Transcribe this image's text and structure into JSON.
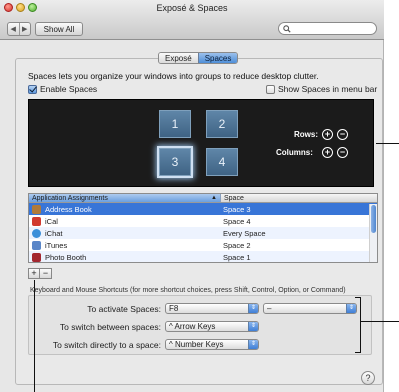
{
  "window": {
    "title": "Exposé & Spaces"
  },
  "toolbar": {
    "back_icon": "◀",
    "forward_icon": "▶",
    "show_all_label": "Show All",
    "search_value": "",
    "search_placeholder": ""
  },
  "tabs": [
    {
      "label": "Exposé",
      "active": false
    },
    {
      "label": "Spaces",
      "active": true
    }
  ],
  "spaces": {
    "intro": "Spaces lets you organize your windows into groups to reduce desktop clutter.",
    "enable_label": "Enable Spaces",
    "enable_checked": true,
    "show_menubar_label": "Show Spaces in menu bar",
    "show_menubar_checked": false,
    "tiles": [
      "1",
      "2",
      "3",
      "4"
    ],
    "selected_tile": "3",
    "rows_label": "Rows:",
    "columns_label": "Columns:",
    "plus": "+",
    "minus": "−"
  },
  "assignments": {
    "headers": {
      "app": "Application Assignments",
      "space": "Space",
      "sort_icon": "▲"
    },
    "rows": [
      {
        "app": "Address Book",
        "space": "Space 3",
        "icon_color": "#b07a3a",
        "selected": true
      },
      {
        "app": "iCal",
        "space": "Space 4",
        "icon_color": "#d13a2e",
        "selected": false
      },
      {
        "app": "iChat",
        "space": "Every Space",
        "icon_color": "#3b8fd9",
        "selected": false
      },
      {
        "app": "iTunes",
        "space": "Space 2",
        "icon_color": "#5a86c8",
        "selected": false
      },
      {
        "app": "Photo Booth",
        "space": "Space 1",
        "icon_color": "#a3272f",
        "selected": false
      }
    ],
    "stepper_icon": "⇕",
    "add_label": "+",
    "remove_label": "−"
  },
  "shortcuts": {
    "title": "Keyboard and Mouse Shortcuts (for more shortcut choices, press Shift, Control, Option, or Command)",
    "activate_label": "To activate Spaces:",
    "activate_value": "F8",
    "activate_mouse_value": "–",
    "switch_between_label": "To switch between spaces:",
    "switch_between_value": "^ Arrow Keys",
    "switch_direct_label": "To switch directly to a space:",
    "switch_direct_value": "^ Number Keys",
    "popup_arrow": "⇕"
  },
  "help_label": "?"
}
